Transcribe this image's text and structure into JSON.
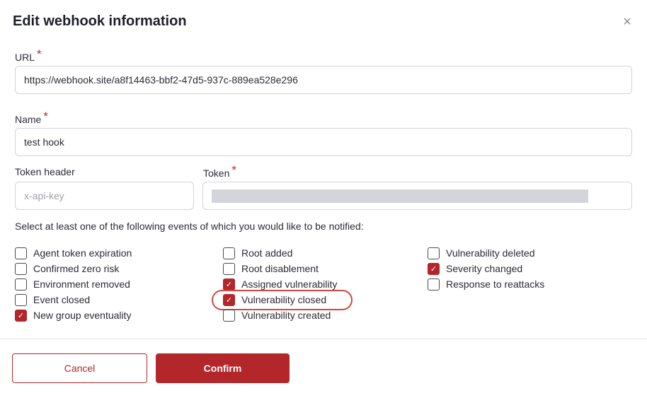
{
  "modal": {
    "title": "Edit webhook information",
    "close_glyph": "×"
  },
  "form": {
    "required_marker": "*",
    "url": {
      "label": "URL",
      "value": "https://webhook.site/a8f14463-bbf2-47d5-937c-889ea528e296"
    },
    "name": {
      "label": "Name",
      "value": "test hook"
    },
    "token_header": {
      "label": "Token header",
      "placeholder": "x-api-key"
    },
    "token": {
      "label": "Token",
      "value_redacted": true
    },
    "instruction": "Select at least one of the following events of which you would like to be notified:"
  },
  "events": {
    "col1": [
      {
        "label": "Agent token expiration",
        "checked": false
      },
      {
        "label": "Confirmed zero risk",
        "checked": false
      },
      {
        "label": "Environment removed",
        "checked": false
      },
      {
        "label": "Event closed",
        "checked": false
      },
      {
        "label": "New group eventuality",
        "checked": true
      }
    ],
    "col2": [
      {
        "label": "Root added",
        "checked": false
      },
      {
        "label": "Root disablement",
        "checked": false
      },
      {
        "label": "Assigned vulnerability",
        "checked": true
      },
      {
        "label": "Vulnerability closed",
        "checked": true,
        "highlighted": true
      },
      {
        "label": "Vulnerability created",
        "checked": false
      }
    ],
    "col3": [
      {
        "label": "Vulnerability deleted",
        "checked": false
      },
      {
        "label": "Severity changed",
        "checked": true
      },
      {
        "label": "Response to reattacks",
        "checked": false
      }
    ],
    "check_glyph": "✓"
  },
  "footer": {
    "cancel_label": "Cancel",
    "confirm_label": "Confirm"
  },
  "colors": {
    "accent": "#b3262a",
    "highlight_ring": "#d6453f"
  }
}
